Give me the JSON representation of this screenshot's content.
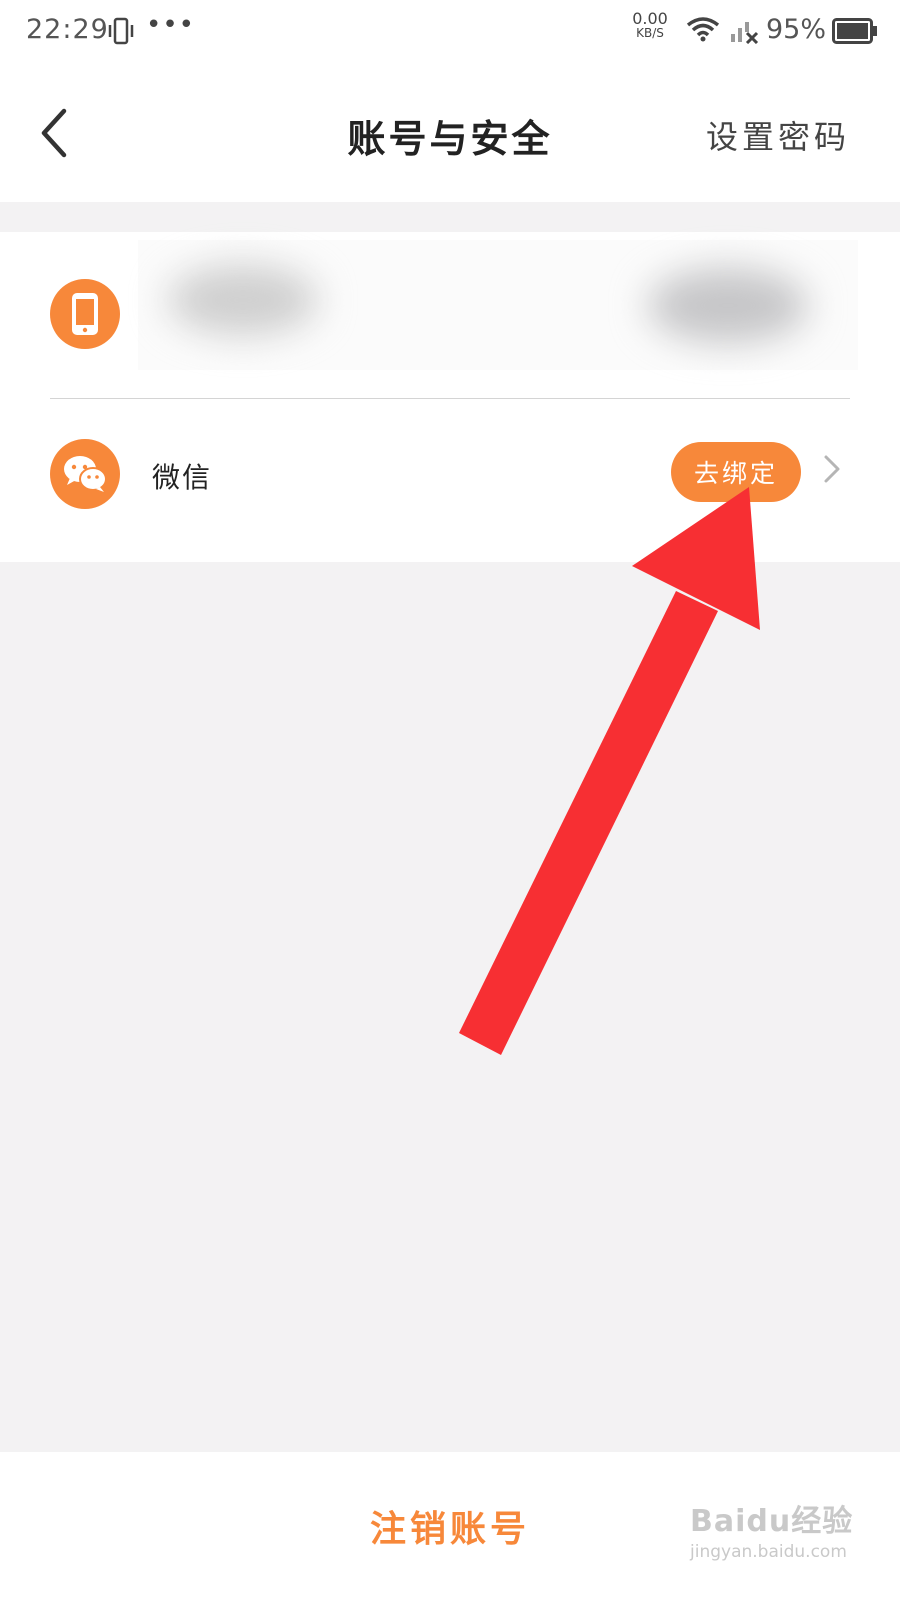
{
  "status_bar": {
    "time": "22:29",
    "dots": "•••",
    "net_speed_value": "0.00",
    "net_speed_unit": "KB/S",
    "battery_percent": "95%"
  },
  "nav": {
    "title": "账号与安全",
    "right_action": "设置密码"
  },
  "accounts": {
    "phone": {
      "icon": "phone-icon",
      "value_obscured": true
    },
    "wechat": {
      "icon": "wechat-icon",
      "label": "微信",
      "action_label": "去绑定"
    }
  },
  "bottom": {
    "cancel_account_label": "注销账号"
  },
  "watermark": {
    "line1": "Baidu经验",
    "line2": "jingyan.baidu.com"
  },
  "colors": {
    "accent": "#f7883a",
    "background": "#f3f2f3",
    "annotation": "#f72f33"
  }
}
